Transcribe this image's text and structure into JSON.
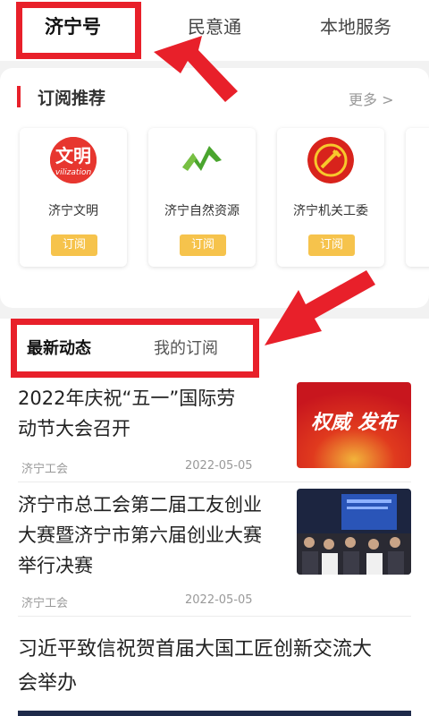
{
  "top_tabs": [
    "济宁号",
    "民意通",
    "本地服务"
  ],
  "subscribe": {
    "title": "订阅推荐",
    "more_label": "更多 >",
    "accounts": [
      {
        "name": "济宁文明",
        "button": "订阅",
        "logo_text": "文明",
        "logo_sub": "vilization"
      },
      {
        "name": "济宁自然资源",
        "button": "订阅"
      },
      {
        "name": "济宁机关工委",
        "button": "订阅"
      }
    ]
  },
  "feed_tabs": [
    "最新动态",
    "我的订阅"
  ],
  "news": [
    {
      "title_lines": [
        "2022年庆祝“五一”国际劳",
        "动节大会召开"
      ],
      "source": "济宁工会",
      "date": "2022-05-05",
      "thumb_text": "权威 发布"
    },
    {
      "title_lines": [
        "济宁市总工会第二届工友创业",
        "大赛暨济宁市第六届创业大赛",
        "举行决赛"
      ],
      "source": "济宁工会",
      "date": "2022-05-05"
    },
    {
      "title_lines": [
        "习近平致信祝贺首届大国工匠创新交流大",
        "会举办"
      ]
    }
  ],
  "colors": {
    "accent_red": "#e8202a",
    "button_yellow": "#f6c34c"
  }
}
